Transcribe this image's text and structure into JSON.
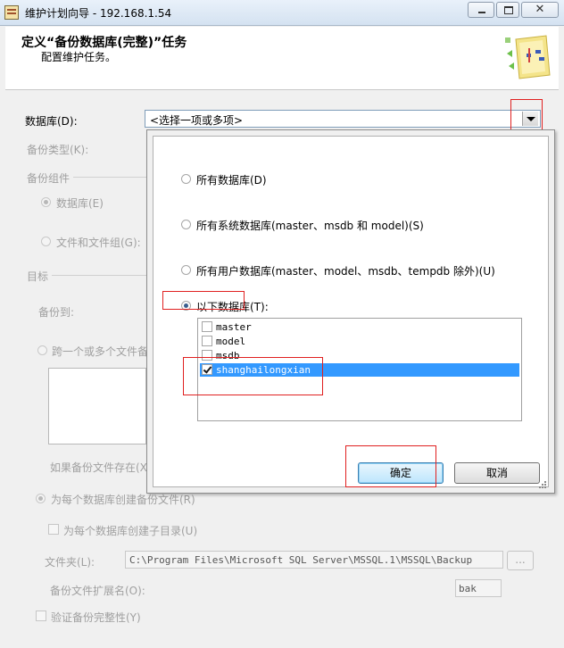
{
  "window": {
    "title": "维护计划向导 - 192.168.1.54",
    "close_glyph": "✕"
  },
  "header": {
    "title": "定义“备份数据库(完整)”任务",
    "subtitle": "配置维护任务。"
  },
  "form": {
    "database_label": "数据库(D):",
    "database_combo_value": "<选择一项或多项>",
    "backup_type_label": "备份类型(K):",
    "backup_component_label": "备份组件",
    "component_database": "数据库(E)",
    "component_files": "文件和文件组(G):",
    "target_label": "目标",
    "backup_to_label": "备份到:",
    "span_files_label": "跨一个或多个文件备",
    "if_exists_label": "如果备份文件存在(X",
    "create_per_db_file": "为每个数据库创建备份文件(R)",
    "create_subdir": "为每个数据库创建子目录(U)",
    "folder_label": "文件夹(L):",
    "folder_value": "C:\\Program Files\\Microsoft SQL Server\\MSSQL.1\\MSSQL\\Backup",
    "browse_label": "...",
    "ext_label": "备份文件扩展名(O):",
    "ext_value": "bak",
    "verify_label": "验证备份完整性(Y)"
  },
  "popup": {
    "options": [
      {
        "label": "所有数据库(D)",
        "selected": false
      },
      {
        "label": "所有系统数据库(master、msdb 和 model)(S)",
        "selected": false
      },
      {
        "label": "所有用户数据库(master、model、msdb、tempdb 除外)(U)",
        "selected": false
      },
      {
        "label": "以下数据库(T):",
        "selected": true
      }
    ],
    "databases": [
      {
        "name": "master",
        "checked": false,
        "highlighted": false
      },
      {
        "name": "model",
        "checked": false,
        "highlighted": false
      },
      {
        "name": "msdb",
        "checked": false,
        "highlighted": false
      },
      {
        "name": "shanghailongxian",
        "checked": true,
        "highlighted": true
      }
    ],
    "ok_label": "确定",
    "cancel_label": "取消"
  },
  "colors": {
    "highlight_box": "#e02020",
    "selection": "#3399ff"
  }
}
